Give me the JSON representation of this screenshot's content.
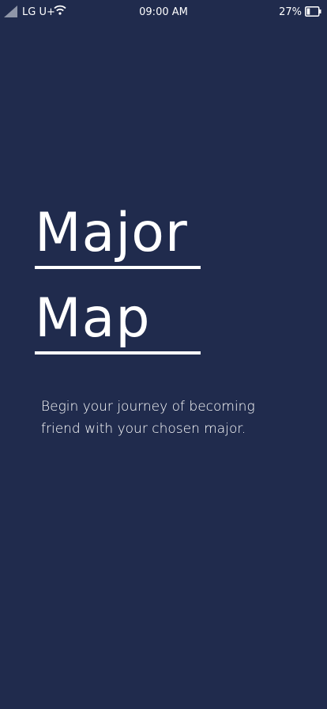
{
  "status_bar": {
    "carrier": "LG U+",
    "time": "09:00 AM",
    "battery_percent": "27%",
    "battery_level": 0.27,
    "icons": [
      "signal-icon",
      "wifi-icon",
      "battery-icon"
    ]
  },
  "splash": {
    "title_line_1": "Major",
    "title_line_2": "Map",
    "tagline": "Begin your journey of becoming friend with your chosen major."
  },
  "colors": {
    "background": "#202b4d",
    "text": "#ffffff"
  }
}
